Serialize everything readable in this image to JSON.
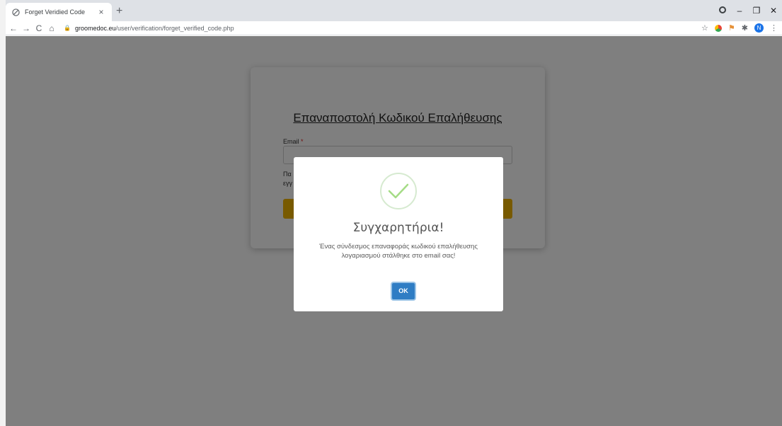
{
  "browser": {
    "tab_title": "Forget Veridied Code",
    "tab_close": "×",
    "new_tab": "+",
    "url_host": "groomedoc.eu",
    "url_path": "/user/verification/forget_verified_code.php",
    "avatar_letter": "N",
    "window_controls": {
      "minimize": "–",
      "maximize": "❐",
      "close": "✕"
    }
  },
  "card": {
    "title": "Επαναποστολή Κωδικού Επαλήθευσης",
    "email_label": "Email",
    "required_mark": "*",
    "help_text": "Πα\nεγγ"
  },
  "modal": {
    "title": "Συγχαρητήρια!",
    "message": "Ένας σύνδεσμος επαναφοράς κωδικού επαλήθευσης λογαριασμού στάλθηκε στο email σας!",
    "ok_label": "OK",
    "success_color": "#a5dc86"
  },
  "colors": {
    "overlay": "rgba(0,0,0,0.5)",
    "submit": "#f0b400",
    "ok_button": "#2f7dc4"
  }
}
